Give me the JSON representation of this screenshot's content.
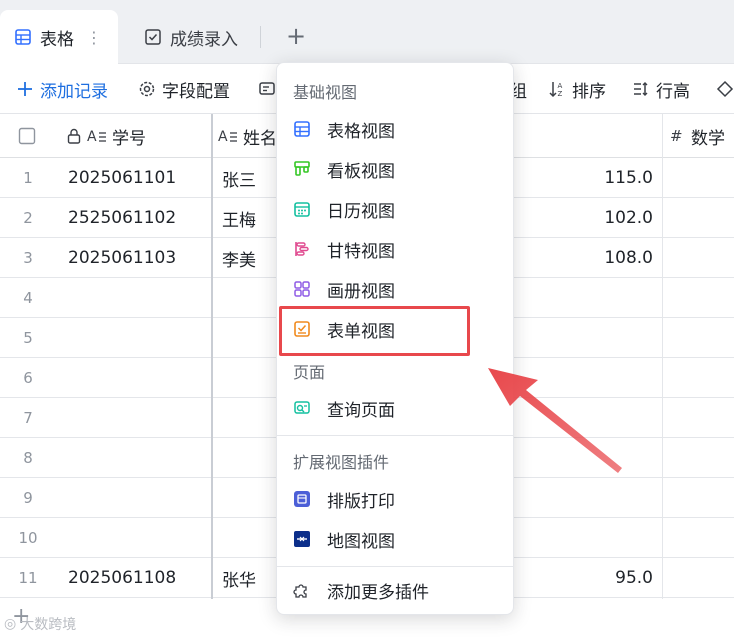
{
  "tabs": [
    {
      "label": "表格",
      "icon": "table-icon",
      "active": true
    },
    {
      "label": "成绩录入",
      "icon": "form-check-icon",
      "active": false
    }
  ],
  "tab_add_label": "+",
  "toolbar": {
    "add_record": "添加记录",
    "field_config": "字段配置",
    "group_suffix": "组",
    "sort": "排序",
    "row_height": "行高"
  },
  "columns": {
    "id": "学号",
    "name": "姓名",
    "math": "数学"
  },
  "rows": [
    {
      "idx": "1",
      "id": "2025061101",
      "name": "张三",
      "score": "115.0"
    },
    {
      "idx": "2",
      "id": "2525061102",
      "name": "王梅",
      "score": "102.0"
    },
    {
      "idx": "3",
      "id": "2025061103",
      "name": "李美",
      "score": "108.0"
    },
    {
      "idx": "4",
      "id": "",
      "name": "",
      "score": ""
    },
    {
      "idx": "5",
      "id": "",
      "name": "",
      "score": ""
    },
    {
      "idx": "6",
      "id": "",
      "name": "",
      "score": ""
    },
    {
      "idx": "7",
      "id": "",
      "name": "",
      "score": ""
    },
    {
      "idx": "8",
      "id": "",
      "name": "",
      "score": ""
    },
    {
      "idx": "9",
      "id": "",
      "name": "",
      "score": ""
    },
    {
      "idx": "10",
      "id": "",
      "name": "",
      "score": ""
    },
    {
      "idx": "11",
      "id": "2025061108",
      "name": "张华",
      "score": "95.0"
    }
  ],
  "menu": {
    "basic_group": "基础视图",
    "basic_items": [
      {
        "label": "表格视图",
        "icon": "grid-view-icon",
        "color": "#3370ff"
      },
      {
        "label": "看板视图",
        "icon": "kanban-icon",
        "color": "#34c724"
      },
      {
        "label": "日历视图",
        "icon": "calendar-icon",
        "color": "#14c0a0"
      },
      {
        "label": "甘特视图",
        "icon": "gantt-icon",
        "color": "#e04a8f"
      },
      {
        "label": "画册视图",
        "icon": "gallery-icon",
        "color": "#8f5ce5"
      },
      {
        "label": "表单视图",
        "icon": "form-view-icon",
        "color": "#f08a1e"
      }
    ],
    "page_group": "页面",
    "page_items": [
      {
        "label": "查询页面",
        "icon": "query-page-icon",
        "color": "#14c0a0"
      }
    ],
    "ext_group": "扩展视图插件",
    "ext_items": [
      {
        "label": "排版打印",
        "icon": "print-layout-icon",
        "color": "#4c5fd7"
      },
      {
        "label": "地图视图",
        "icon": "map-view-icon",
        "color": "#0b2e8a"
      }
    ],
    "more_plugins": "添加更多插件"
  },
  "watermark": "大数跨境",
  "colors": {
    "accent": "#1f6fe0",
    "highlight": "#e8484c"
  }
}
